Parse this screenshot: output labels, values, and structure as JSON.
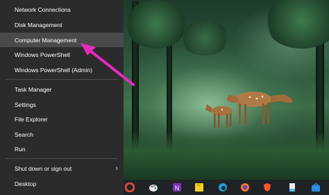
{
  "menu": {
    "items": [
      {
        "label": "Network Connections"
      },
      {
        "label": "Disk Management"
      },
      {
        "label": "Computer Management"
      },
      {
        "label": "Windows PowerShell"
      },
      {
        "label": "Windows PowerShell (Admin)"
      },
      {
        "label": "Task Manager"
      },
      {
        "label": "Settings"
      },
      {
        "label": "File Explorer"
      },
      {
        "label": "Search"
      },
      {
        "label": "Run"
      },
      {
        "label": "Shut down or sign out"
      },
      {
        "label": "Desktop"
      }
    ],
    "highlighted": "Computer Management",
    "submenu_chevron": "›"
  },
  "annotation": {
    "arrow_color": "#e62ac0",
    "points_to": "Computer Management"
  },
  "taskbar": {
    "icons": [
      "chrome-partial-icon",
      "paint-icon",
      "onenote-icon",
      "sticky-notes-icon",
      "edge-icon",
      "firefox-icon",
      "brave-icon",
      "file-icon",
      "store-icon"
    ]
  },
  "colors": {
    "menu_bg": "#2b2b2b",
    "menu_hover": "#4a4a4a",
    "text": "#ffffff",
    "taskbar_bg": "#1f2326"
  }
}
